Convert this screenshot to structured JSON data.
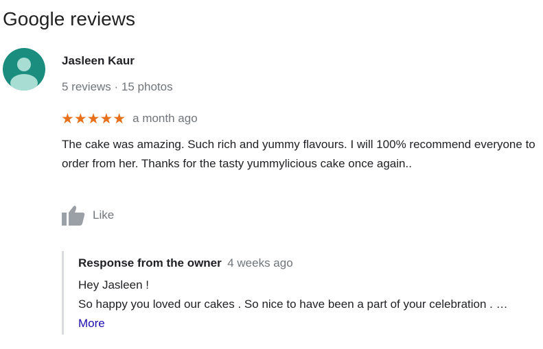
{
  "page": {
    "title": "Google reviews"
  },
  "review": {
    "avatar_icon": "user-silhouette-icon",
    "avatar_color": "#1a8d7e",
    "reviewer_name": "Jasleen Kaur",
    "reviewer_meta": "5 reviews · 15 photos",
    "rating": 5,
    "rating_max": 5,
    "stars_text": "★★★★★",
    "star_color": "#e7711b",
    "time": "a month ago",
    "text": "The cake was amazing. Such rich and yummy flavours. I will 100% recommend everyone to order from her. Thanks for the tasty yummylicious cake once again..",
    "like_icon": "thumbs-up-icon",
    "like_label": "Like"
  },
  "owner_response": {
    "label": "Response from the owner",
    "time": "4 weeks ago",
    "greeting": "Hey Jasleen !",
    "text": "So happy you loved our cakes . So nice to have been a part of your celebration . …",
    "more_label": "More",
    "link_color": "#1a0dab"
  }
}
